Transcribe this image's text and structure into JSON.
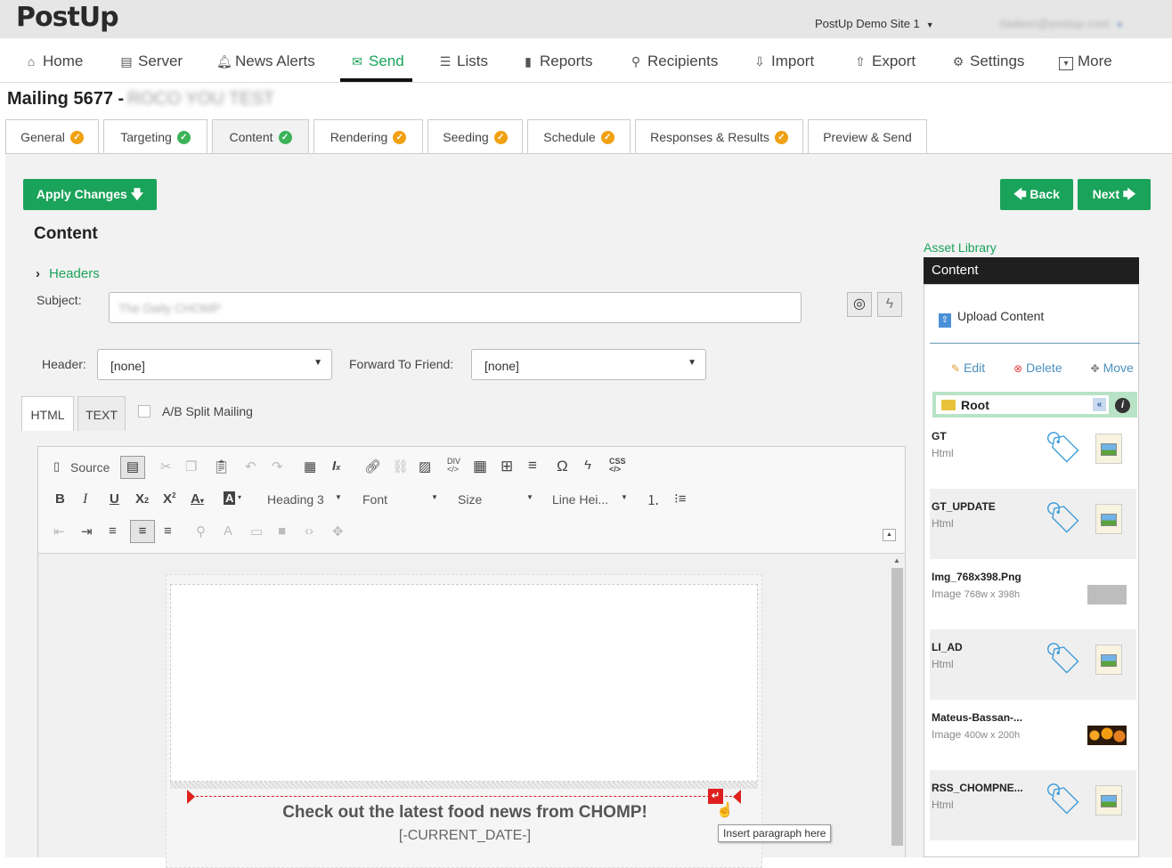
{
  "app": {
    "logo": "PostUp",
    "site": "PostUp Demo Site 1",
    "user": "rladeen@postup.com"
  },
  "nav": [
    {
      "label": "Home",
      "icon": "home-icon",
      "glyph": "⌂"
    },
    {
      "label": "Server",
      "icon": "server-icon",
      "glyph": "▤"
    },
    {
      "label": "News Alerts",
      "icon": "bell-icon",
      "glyph": "🔔︎"
    },
    {
      "label": "Send",
      "icon": "envelope-icon",
      "glyph": "✉"
    },
    {
      "label": "Lists",
      "icon": "list-icon",
      "glyph": "☰"
    },
    {
      "label": "Reports",
      "icon": "bar-chart-icon",
      "glyph": "▮"
    },
    {
      "label": "Recipients",
      "icon": "search-icon",
      "glyph": "⚲"
    },
    {
      "label": "Import",
      "icon": "import-icon",
      "glyph": "⇩"
    },
    {
      "label": "Export",
      "icon": "export-icon",
      "glyph": "⇧"
    },
    {
      "label": "Settings",
      "icon": "gear-icon",
      "glyph": "⚙"
    },
    {
      "label": "More",
      "icon": "more-icon",
      "glyph": "▾"
    }
  ],
  "mailing": {
    "title": "Mailing 5677 -",
    "name": "ROCO YOU TEST"
  },
  "tabs": [
    {
      "label": "General",
      "status": "orange"
    },
    {
      "label": "Targeting",
      "status": "green"
    },
    {
      "label": "Content",
      "status": "green"
    },
    {
      "label": "Rendering",
      "status": "orange"
    },
    {
      "label": "Seeding",
      "status": "orange"
    },
    {
      "label": "Schedule",
      "status": "orange"
    },
    {
      "label": "Responses & Results",
      "status": "orange"
    },
    {
      "label": "Preview & Send",
      "status": ""
    }
  ],
  "buttons": {
    "apply": "Apply Changes 🡇",
    "back": "🡄 Back",
    "next": "Next 🡆"
  },
  "content": {
    "heading": "Content",
    "headers_link": "Headers",
    "subject_label": "Subject:",
    "subject_value": "The Daily CHOMP",
    "header_label": "Header:",
    "header_value": "[none]",
    "ftf_label": "Forward To Friend:",
    "ftf_value": "[none]",
    "tab_html": "HTML",
    "tab_text": "TEXT",
    "ab_split": "A/B Split Mailing"
  },
  "toolbar": {
    "source": "Source",
    "heading": "Heading 3",
    "font": "Font",
    "size": "Size",
    "line_height": "Line Hei..."
  },
  "editor": {
    "headline": "Check out the latest food news from CHOMP!",
    "date_token": "[-CURRENT_DATE-]",
    "tooltip": "Insert paragraph here"
  },
  "assets": {
    "title": "Asset Library",
    "header": "Content",
    "upload": "Upload Content",
    "edit": "Edit",
    "delete": "Delete",
    "move": "Move",
    "root": "Root",
    "items": [
      {
        "name": "GT",
        "type": "Html",
        "dims": "",
        "thumb": "tag"
      },
      {
        "name": "GT_UPDATE",
        "type": "Html",
        "dims": "",
        "thumb": "tag"
      },
      {
        "name": "Img_768x398.Png",
        "type": "Image",
        "dims": "768w x 398h",
        "thumb": "gray"
      },
      {
        "name": "LI_AD",
        "type": "Html",
        "dims": "",
        "thumb": "tag"
      },
      {
        "name": "Mateus-Bassan-...",
        "type": "Image",
        "dims": "400w x 200h",
        "thumb": "orange"
      },
      {
        "name": "RSS_CHOMPNE...",
        "type": "Html",
        "dims": "",
        "thumb": "tag"
      }
    ]
  },
  "colors": {
    "brand_green": "#1aa35a",
    "check_orange": "#f0a011",
    "check_green": "#3cb357"
  }
}
